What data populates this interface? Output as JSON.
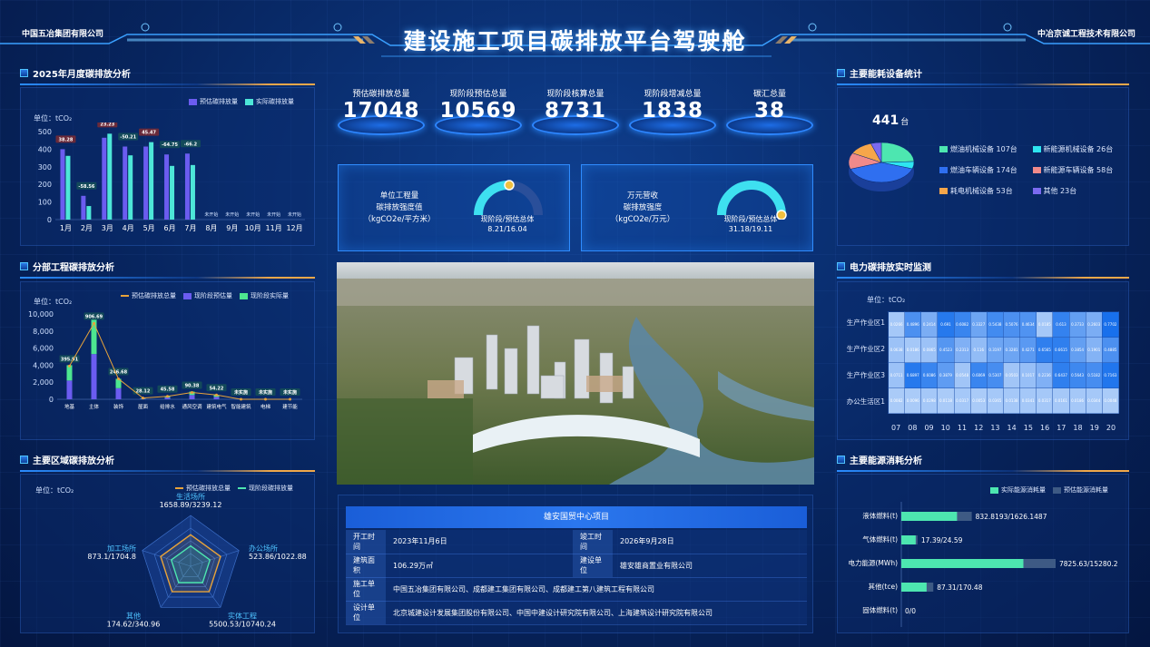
{
  "header": {
    "left_company": "中国五冶集团有限公司",
    "right_company": "中冶京诚工程技术有限公司",
    "title": "建设施工项目碳排放平台驾驶舱"
  },
  "monthly": {
    "title": "2025年月度碳排放分析",
    "unit": "单位：tCO₂",
    "legend_est": "预估碳排放量",
    "legend_act": "实际碳排放量",
    "chart_data": {
      "type": "bar",
      "categories": [
        "1月",
        "2月",
        "3月",
        "4月",
        "5月",
        "6月",
        "7月",
        "8月",
        "9月",
        "10月",
        "11月",
        "12月"
      ],
      "series": [
        {
          "name": "预估碳排放量",
          "values": [
            400,
            135,
            465,
            415,
            415,
            370,
            375,
            null,
            null,
            null,
            null,
            null
          ]
        },
        {
          "name": "实际碳排放量",
          "values": [
            362,
            77,
            488,
            365,
            440,
            305,
            310,
            null,
            null,
            null,
            null,
            null
          ]
        }
      ],
      "data_labels": [
        "38.28",
        "-58.56",
        "23.23",
        "-50.21",
        "45.47",
        "-64.75",
        "-66.2",
        "未开始",
        "未开始",
        "未开始",
        "未开始",
        "未开始"
      ],
      "label_positive": [
        true,
        false,
        true,
        false,
        true,
        false,
        false
      ],
      "yticks": [
        "0",
        "100",
        "200",
        "300",
        "400",
        "500"
      ],
      "ylim": [
        0,
        500
      ]
    }
  },
  "sub": {
    "title": "分部工程碳排放分析",
    "unit": "单位：tCO₂",
    "legend_line": "预估碳排放总量",
    "legend_est": "现阶段预估量",
    "legend_act": "现阶段实际量",
    "chart_data": {
      "type": "bar",
      "categories": [
        "地基",
        "主体",
        "装饰",
        "屋面",
        "给排水",
        "通风空调",
        "建筑电气",
        "智能建筑",
        "电梯",
        "建节能"
      ],
      "series": [
        {
          "name": "预估碳排放总量",
          "values": [
            3900,
            8900,
            2400,
            150,
            350,
            800,
            500,
            0,
            0,
            0
          ]
        },
        {
          "name": "现阶段预估量",
          "values": [
            2200,
            5300,
            1300,
            70,
            200,
            500,
            280,
            0,
            0,
            0
          ]
        },
        {
          "name": "现阶段实际量",
          "values": [
            1800,
            4200,
            1100,
            50,
            150,
            400,
            200,
            0,
            0,
            0
          ]
        }
      ],
      "data_labels": [
        "395.91",
        "906.69",
        "246.68",
        "28.12",
        "45.58",
        "90.38",
        "54.22",
        "未实施",
        "未实施",
        "未实施"
      ],
      "yticks": [
        "0",
        "2,000",
        "4,000",
        "6,000",
        "8,000",
        "10,000"
      ],
      "ylim": [
        0,
        10000
      ]
    }
  },
  "region": {
    "title": "主要区域碳排放分析",
    "unit": "单位：tCO₂",
    "legend_total": "预估碳排放总量",
    "legend_current": "现阶段碳排放量",
    "axes": [
      {
        "name": "生活场所",
        "value": "1658.89/3239.12"
      },
      {
        "name": "办公场所",
        "value": "523.86/1022.88"
      },
      {
        "name": "实体工程",
        "value": "5500.53/10740.24"
      },
      {
        "name": "其他",
        "value": "174.62/340.96"
      },
      {
        "name": "加工场所",
        "value": "873.1/1704.8"
      }
    ],
    "chart_data": {
      "type": "radar",
      "series": [
        {
          "name": "预估碳排放总量",
          "values": [
            0.62,
            0.62,
            0.62,
            0.62,
            0.62
          ]
        },
        {
          "name": "现阶段碳排放量",
          "values": [
            0.4,
            0.4,
            0.4,
            0.4,
            0.4
          ]
        }
      ]
    }
  },
  "stats": [
    {
      "label": "预估碳排放总量",
      "value": "17048"
    },
    {
      "label": "现阶段预估总量",
      "value": "10569"
    },
    {
      "label": "现阶段核算总量",
      "value": "8731"
    },
    {
      "label": "现阶段增减总量",
      "value": "1838"
    },
    {
      "label": "碳汇总量",
      "value": "38"
    }
  ],
  "kpi": [
    {
      "l1": "单位工程量",
      "l2": "碳排放强度值",
      "l3": "（kgCO2e/平方米）",
      "sub": "现阶段/预估总体",
      "val": "8.21/16.04",
      "ratio": 0.51
    },
    {
      "l1": "万元营收",
      "l2": "碳排放强度",
      "l3": "（kgCO2e/万元）",
      "sub": "现阶段/预估总体",
      "val": "31.18/19.11",
      "ratio": 1.0
    }
  ],
  "project": {
    "name": "雄安国贸中心项目",
    "rows": [
      {
        "k1": "开工时间",
        "v1": "2023年11月6日",
        "k2": "竣工时间",
        "v2": "2026年9月28日"
      },
      {
        "k1": "建筑面积",
        "v1": "106.29万㎡",
        "k2": "建设单位",
        "v2": "雄安雄商置业有限公司"
      }
    ],
    "builder_k": "施工单位",
    "builder_v": "中国五冶集团有限公司、成都建工集团有限公司、成都建工第八建筑工程有限公司",
    "designer_k": "设计单位",
    "designer_v": "北京城建设计发展集团股份有限公司、中国中建设计研究院有限公司、上海建筑设计研究院有限公司"
  },
  "equip": {
    "title": "主要能耗设备统计",
    "total": "441",
    "total_unit": "台",
    "items": [
      {
        "name": "燃油机械设备 107台",
        "color": "#4de6b0",
        "value": 107
      },
      {
        "name": "新能源机械设备 26台",
        "color": "#2ee5f0",
        "value": 26
      },
      {
        "name": "燃油车辆设备 174台",
        "color": "#2f6ff0",
        "value": 174
      },
      {
        "name": "新能源车辆设备 58台",
        "color": "#f08a8a",
        "value": 58
      },
      {
        "name": "耗电机械设备 53台",
        "color": "#f6a64a",
        "value": 53
      },
      {
        "name": "其他 23台",
        "color": "#7b6af0",
        "value": 23
      }
    ],
    "chart_data": {
      "type": "pie",
      "labels": [
        "燃油机械设备",
        "新能源机械设备",
        "燃油车辆设备",
        "新能源车辆设备",
        "耗电机械设备",
        "其他"
      ],
      "values": [
        107,
        26,
        174,
        58,
        53,
        23
      ]
    }
  },
  "power": {
    "title": "电力碳排放实时监测",
    "unit": "单位：tCO₂",
    "rows": [
      "生产作业区1",
      "生产作业区2",
      "生产作业区3",
      "办公生活区1"
    ],
    "cols": [
      "07",
      "08",
      "09",
      "10",
      "11",
      "12",
      "13",
      "14",
      "15",
      "16",
      "17",
      "18",
      "19",
      "20"
    ],
    "chart_data": {
      "type": "heatmap",
      "cells": [
        [
          "0.0266",
          "0.4896",
          "0.2414",
          "0.691",
          "0.6082",
          "0.3327",
          "0.5438",
          "0.5076",
          "0.4634",
          "0.0185",
          "0.613",
          "0.3733",
          "0.2603",
          "0.7702"
        ],
        [
          "0.0638",
          "0.0186",
          "0.0865",
          "0.4523",
          "0.2313",
          "0.116",
          "0.3197",
          "0.3281",
          "0.4271",
          "0.6565",
          "0.6615",
          "0.3854",
          "0.1901",
          "0.4885"
        ],
        [
          "0.0711",
          "0.6897",
          "0.6086",
          "0.3879",
          "0.0548",
          "0.6069",
          "0.5307",
          "0.0503",
          "0.1017",
          "0.2236",
          "0.6437",
          "0.5643",
          "0.5182",
          "0.7163"
        ],
        [
          "0.0082",
          "0.0096",
          "0.0298",
          "0.0118",
          "0.0317",
          "0.0053",
          "0.0365",
          "0.0138",
          "0.0341",
          "0.0317",
          "0.0161",
          "0.0186",
          "0.0344",
          "0.0048"
        ]
      ]
    }
  },
  "energy": {
    "title": "主要能源消耗分析",
    "legend_act": "实际能源消耗量",
    "legend_est": "预估能源消耗量",
    "chart_data": {
      "type": "bar",
      "categories": [
        "液体燃料(t)",
        "气体燃料(t)",
        "电力能源(MWh)",
        "其他(tce)",
        "固体燃料(t)"
      ],
      "series": [
        {
          "name": "实际能源消耗量",
          "values": [
            832.8193,
            17.39,
            7825.63,
            87.31,
            0
          ]
        },
        {
          "name": "预估能源消耗量",
          "values": [
            1626.1487,
            24.59,
            15280.2,
            170.48,
            0
          ]
        }
      ],
      "labels": [
        "832.8193/1626.1487",
        "17.39/24.59",
        "7825.63/15280.2",
        "87.31/170.48",
        "0/0"
      ]
    }
  }
}
